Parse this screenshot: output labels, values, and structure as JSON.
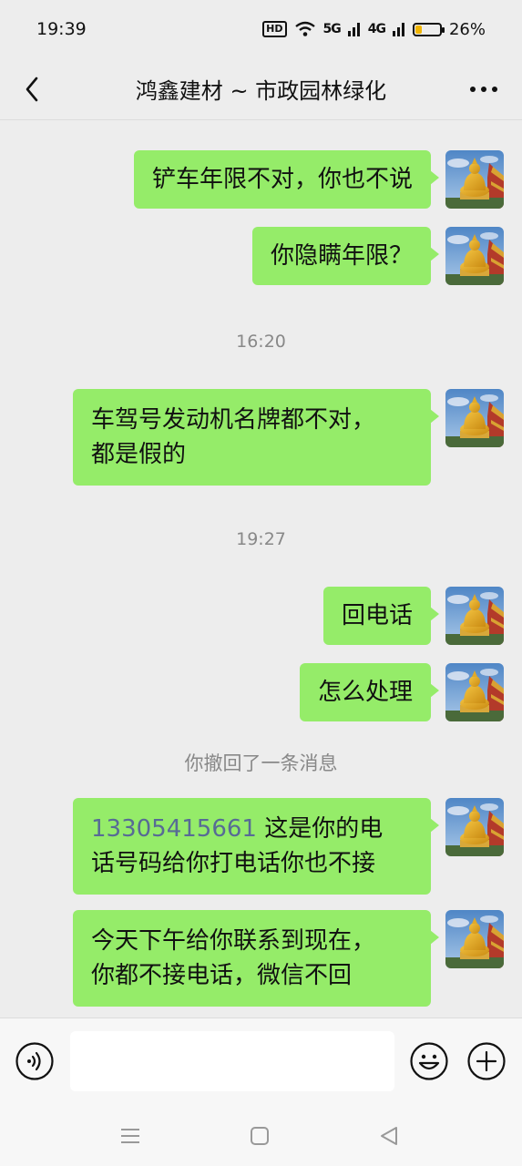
{
  "status_bar": {
    "time": "19:39",
    "hd_label": "HD",
    "net1": "5G",
    "net2": "4G",
    "battery_text": "26%",
    "battery_level": 0.26
  },
  "header": {
    "title": "鸿鑫建材 ~ 市政园林绿化"
  },
  "messages": [
    {
      "type": "sent",
      "text": "铲车年限不对，你也不说"
    },
    {
      "type": "sent",
      "text": "你隐瞒年限？"
    },
    {
      "type": "time",
      "text": "16:20"
    },
    {
      "type": "sent",
      "lines": [
        "车驾号发动机名牌都不对，",
        "都是假的"
      ]
    },
    {
      "type": "time",
      "text": "19:27"
    },
    {
      "type": "sent",
      "text": "回电话"
    },
    {
      "type": "sent",
      "text": "怎么处理"
    },
    {
      "type": "system",
      "text": "你撤回了一条消息"
    },
    {
      "type": "sent",
      "phone": "13305415661",
      "lines": [
        " 这是你的电",
        "话号码给你打电话你也不接"
      ]
    },
    {
      "type": "sent",
      "lines": [
        "今天下午给你联系到现在，",
        "你都不接电话，微信不回"
      ]
    }
  ],
  "input": {
    "placeholder": ""
  },
  "icons": {
    "back": "chevron-left-icon",
    "more": "more-dots-icon",
    "voice": "voice-icon",
    "emoji": "emoji-icon",
    "plus": "plus-icon",
    "menu": "menu-icon",
    "home": "home-icon",
    "nav_back": "triangle-back-icon"
  },
  "colors": {
    "bubble": "#95ec69",
    "background": "#ededed",
    "link": "#576b95"
  }
}
